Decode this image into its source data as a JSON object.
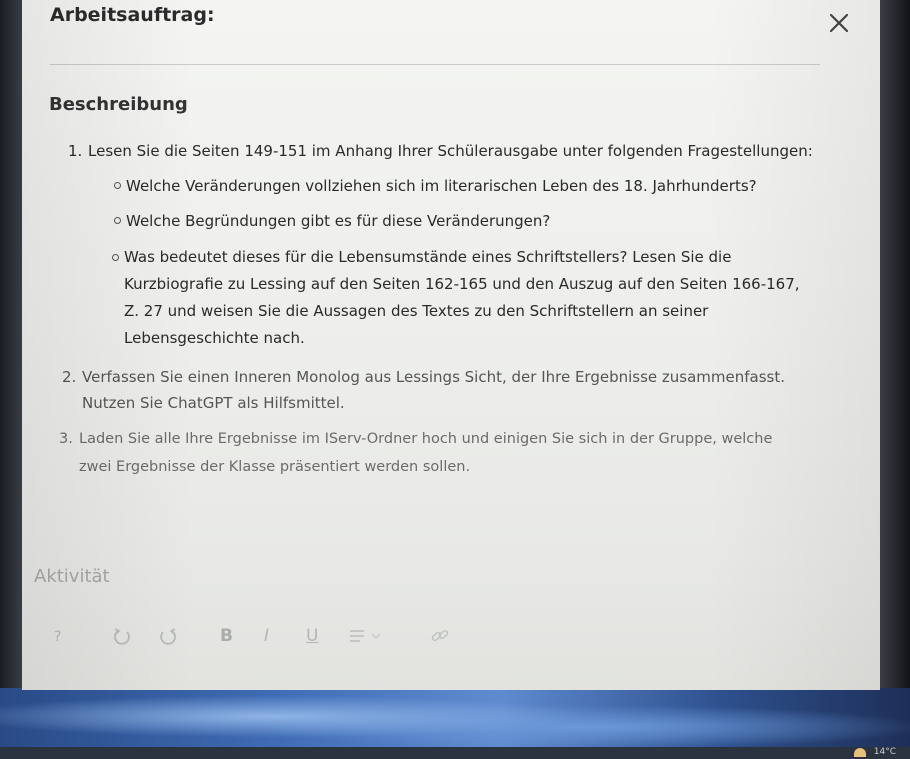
{
  "modal": {
    "title": "Arbeitsauftrag:",
    "section_heading": "Beschreibung",
    "tasks": [
      {
        "number": "1.",
        "lines": [
          "Lesen Sie die Seiten 149-151 im Anhang Ihrer Schülerausgabe unter folgenden Fragestellungen:"
        ],
        "subitems": [
          {
            "lines": [
              "Welche Veränderungen vollziehen sich im literarischen Leben des 18. Jahrhunderts?"
            ]
          },
          {
            "lines": [
              "Welche Begründungen gibt es für diese Veränderungen?"
            ]
          },
          {
            "lines": [
              "Was bedeutet dieses für die Lebensumstände eines Schriftstellers? Lesen Sie die",
              "Kurzbiografie zu Lessing auf den Seiten 162-165 und den Auszug auf den Seiten 166-167,",
              "Z. 27 und weisen Sie die Aussagen des Textes zu den Schriftstellern an seiner",
              "Lebensgeschichte nach."
            ]
          }
        ]
      },
      {
        "number": "2.",
        "lines": [
          "Verfassen Sie einen Inneren Monolog aus Lessings Sicht, der Ihre Ergebnisse zusammenfasst.",
          "Nutzen Sie ChatGPT als Hilfsmittel."
        ]
      },
      {
        "number": "3.",
        "lines": [
          "Laden Sie alle Ihre Ergebnisse im IServ-Ordner hoch und einigen Sie sich in der Gruppe, welche",
          "zwei Ergebnisse der Klasse präsentiert werden sollen."
        ]
      }
    ],
    "activity_label": "Aktivität",
    "toolbar": {
      "help": "?",
      "bold": "B",
      "italic": "I",
      "underline": "U"
    }
  },
  "taskbar": {
    "weather": "14°C"
  },
  "colors": {
    "background": "#f1f2ef",
    "text": "#2a2a2a",
    "muted": "#a5a8a6"
  }
}
